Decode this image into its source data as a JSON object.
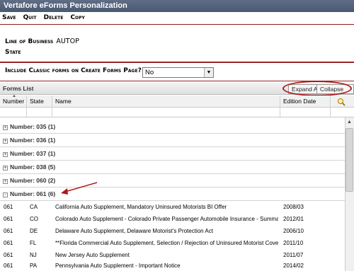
{
  "title": "Vertafore eForms Personalization",
  "menu": [
    "Save",
    "Quit",
    "Delete",
    "Copy"
  ],
  "lob": {
    "label": "Line of Business",
    "value": "AUTOP"
  },
  "state": {
    "label": "State"
  },
  "classic": {
    "label": "Include Classic forms on Create Forms Page?",
    "value": "No"
  },
  "forms": {
    "header": "Forms List",
    "expand_label": "Expand All",
    "collapse_label": "Collapse All",
    "columns": {
      "number": "Number",
      "state": "State",
      "name": "Name",
      "date": "Edition Date"
    },
    "groups": [
      {
        "sign": "+",
        "label": "Number: 035 (1)"
      },
      {
        "sign": "+",
        "label": "Number: 036 (1)"
      },
      {
        "sign": "+",
        "label": "Number: 037 (1)"
      },
      {
        "sign": "+",
        "label": "Number: 038 (5)"
      },
      {
        "sign": "+",
        "label": "Number: 060 (2)"
      },
      {
        "sign": "-",
        "label": "Number: 061 (6)"
      }
    ],
    "rows": [
      {
        "number": "061",
        "state": "CA",
        "name": "California Auto Supplement, Mandatory Uninsured Motorists BI Offer",
        "date": "2008/03"
      },
      {
        "number": "061",
        "state": "CO",
        "name": "Colorado Auto Supplement - Colorado Private Passenger Automobile Insurance - Summary Discl...",
        "date": "2012/01"
      },
      {
        "number": "061",
        "state": "DE",
        "name": "Delaware Auto Supplement, Delaware Motorist's Protection Act",
        "date": "2006/10"
      },
      {
        "number": "061",
        "state": "FL",
        "name": "**Florida Commercial Auto Supplement, Selection / Rejection of Uninsured Motorist Coverage",
        "date": "2011/10"
      },
      {
        "number": "061",
        "state": "NJ",
        "name": "New Jersey Auto Supplement",
        "date": "2011/07"
      },
      {
        "number": "061",
        "state": "PA",
        "name": "Pennsylvania Auto Supplement - Important Notice",
        "date": "2014/02"
      }
    ]
  },
  "colors": {
    "titlebar": "#4f5d75",
    "accent_red": "#9a2424",
    "annotation_red": "#b01818"
  },
  "icons": [
    "search-icon",
    "expand-plus-icon",
    "collapse-minus-icon",
    "sort-up-icon",
    "dropdown-arrow-icon",
    "scroll-up-icon"
  ]
}
